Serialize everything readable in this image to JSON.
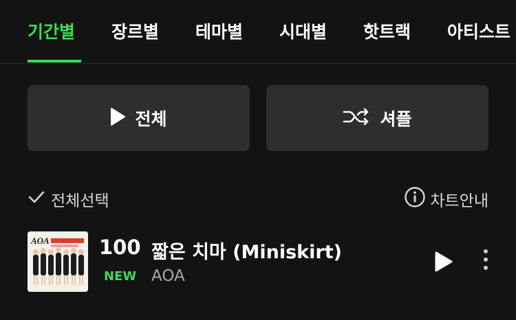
{
  "tabs": [
    {
      "label": "기간별",
      "active": true
    },
    {
      "label": "장르별"
    },
    {
      "label": "테마별"
    },
    {
      "label": "시대별"
    },
    {
      "label": "핫트랙"
    },
    {
      "label": "아티스트"
    }
  ],
  "actions": {
    "play_all_label": "전체",
    "shuffle_label": "셔플"
  },
  "list_header": {
    "select_all_label": "전체선택",
    "chart_info_label": "차트안내"
  },
  "tracks": [
    {
      "rank": "100",
      "badge": "NEW",
      "title": "짧은 치마 (Miniskirt)",
      "artist": "AOA",
      "album_text": "AOA"
    }
  ],
  "colors": {
    "accent": "#3fdb55",
    "background": "#131313",
    "button_bg": "#2e2e2e",
    "muted_text": "#a9a9a9"
  },
  "icons": {
    "play_all": "play-icon",
    "shuffle": "shuffle-icon",
    "select_all": "check-icon",
    "chart_info": "info-circle-icon",
    "track_play": "play-icon",
    "track_more": "more-vertical-icon"
  }
}
